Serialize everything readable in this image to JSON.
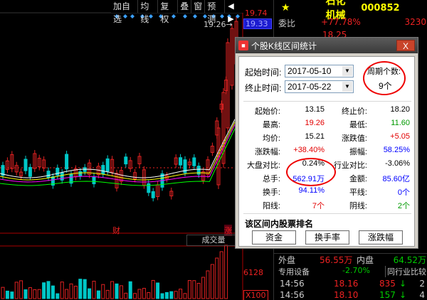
{
  "toolbar": {
    "buttons": [
      "加自选",
      "均线",
      "复权",
      "叠",
      "窗",
      "预测"
    ],
    "arrow": "◀ ▶"
  },
  "chart": {
    "price_high_label": "19.74",
    "price_current_label": "19.33",
    "peak_label": "19.26",
    "peak_arrow": "→",
    "cai_badge": "财",
    "zhang_badge": "涨",
    "vol_tab": "成交量",
    "vol_value": "6128",
    "vol_scale": "X100"
  },
  "quote": {
    "name": "石化机械",
    "code": "000852",
    "star": "★",
    "weibi_label": "委比",
    "weibi_value": "+77.78%",
    "weicha_value": "3230",
    "price_1": "18.25",
    "waipan_label": "外盘",
    "waipan_value": "56.55万",
    "neipan_label": "内盘",
    "neipan_value": "64.52万",
    "industry": "专用设备",
    "industry_change": "-2.70%",
    "industry_rank": "同行业比较",
    "ticks": [
      {
        "time": "14:56",
        "price": "18.16",
        "vol": "835",
        "dir": "↓",
        "flag": "2"
      },
      {
        "time": "14:56",
        "price": "18.10",
        "vol": "157",
        "dir": "↓",
        "flag": "4"
      }
    ]
  },
  "dialog": {
    "title": "个股K线区间统计",
    "close": "X",
    "start_label": "起始时间:",
    "start_value": "2017-05-10",
    "end_label": "终止时间:",
    "end_value": "2017-05-22",
    "period_label": "周期个数:",
    "period_value": "9个",
    "stats": [
      {
        "l1": "起始价:",
        "v1": "13.15",
        "c1": "black",
        "l2": "终止价:",
        "v2": "18.20",
        "c2": "black"
      },
      {
        "l1": "最高:",
        "v1": "19.26",
        "c1": "red",
        "l2": "最低:",
        "v2": "11.60",
        "c2": "green"
      },
      {
        "l1": "均价:",
        "v1": "15.21",
        "c1": "black",
        "l2": "涨跌值:",
        "v2": "+5.05",
        "c2": "red"
      },
      {
        "l1": "涨跌幅:",
        "v1": "+38.40%",
        "c1": "red",
        "l2": "振幅:",
        "v2": "58.25%",
        "c2": "blue"
      },
      {
        "l1": "大盘对比:",
        "v1": "0.24%",
        "c1": "black",
        "l2": "行业对比:",
        "v2": "-3.06%",
        "c2": "black"
      },
      {
        "l1": "总手:",
        "v1": "562.91万",
        "c1": "blue",
        "l2": "金额:",
        "v2": "85.60亿",
        "c2": "blue"
      },
      {
        "l1": "换手:",
        "v1": "94.11%",
        "c1": "blue",
        "l2": "平线:",
        "v2": "0个",
        "c2": "blue"
      },
      {
        "l1": "阳线:",
        "v1": "7个",
        "c1": "red",
        "l2": "阴线:",
        "v2": "2个",
        "c2": "green"
      }
    ],
    "rank_title": "该区间内股票排名",
    "rank_buttons": [
      "资金",
      "换手率",
      "涨跌幅"
    ]
  },
  "colors": {
    "up": "#e22222",
    "down": "#00c8c8",
    "ma5": "#ffffff",
    "ma10": "#ffff00",
    "ma20": "#ff00ff",
    "ma60": "#00ff00"
  }
}
